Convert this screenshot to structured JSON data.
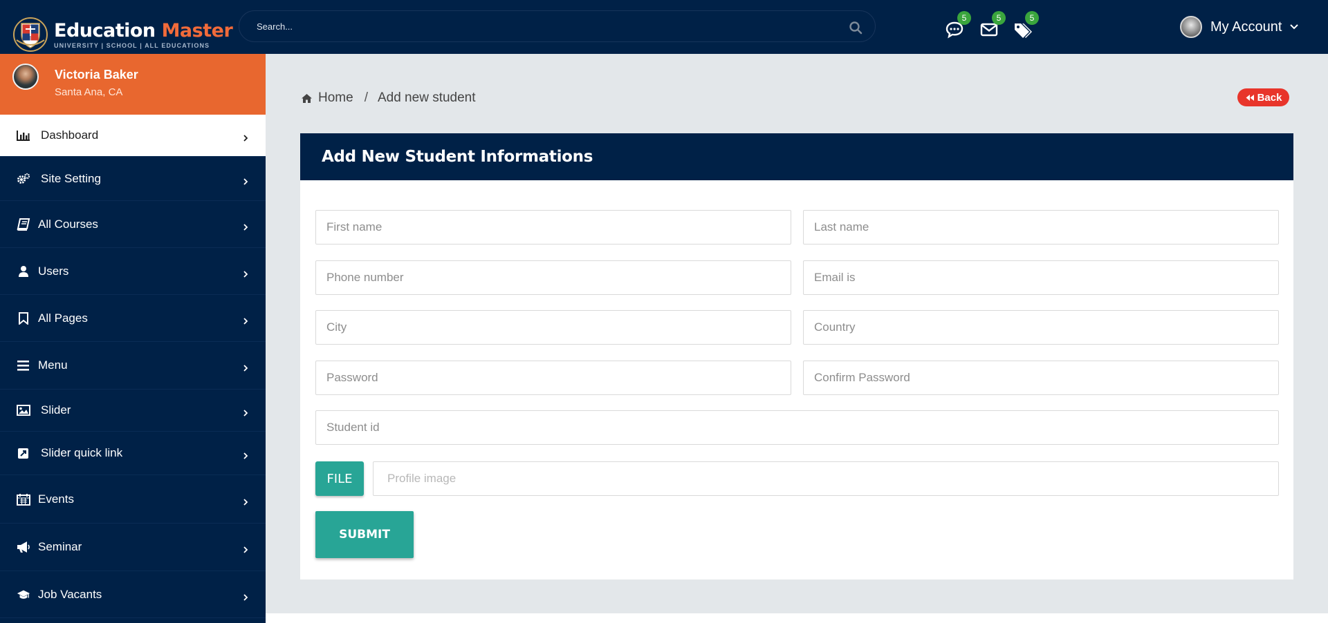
{
  "brand": {
    "name_part1": "Education",
    "name_part2": "Master",
    "tagline": "UNIVERSITY | SCHOOL | ALL EDUCATIONS",
    "accent_color": "#f26b3a",
    "navy_color": "#002147"
  },
  "search": {
    "placeholder": "Search..."
  },
  "notifications": [
    {
      "icon": "chat-icon",
      "count": "5"
    },
    {
      "icon": "envelope-icon",
      "count": "5"
    },
    {
      "icon": "tags-icon",
      "count": "5"
    }
  ],
  "account": {
    "label": "My Account"
  },
  "user": {
    "name": "Victoria Baker",
    "location": "Santa Ana, CA"
  },
  "sidebar": {
    "items": [
      {
        "label": "Dashboard",
        "icon": "bar-chart-icon",
        "active": true
      },
      {
        "label": "Site Setting",
        "icon": "gears-icon"
      },
      {
        "label": "All Courses",
        "icon": "book-icon"
      },
      {
        "label": "Users",
        "icon": "user-icon"
      },
      {
        "label": "All Pages",
        "icon": "bookmark-icon"
      },
      {
        "label": "Menu",
        "icon": "bars-icon"
      },
      {
        "label": "Slider",
        "icon": "image-icon"
      },
      {
        "label": "Slider quick link",
        "icon": "external-link-icon"
      },
      {
        "label": "Events",
        "icon": "calendar-icon"
      },
      {
        "label": "Seminar",
        "icon": "bullhorn-icon"
      },
      {
        "label": "Job Vacants",
        "icon": "graduation-cap-icon"
      }
    ]
  },
  "breadcrumb": {
    "home": "Home",
    "separator": "/",
    "current": "Add new student"
  },
  "back_button": {
    "label": "Back"
  },
  "form": {
    "title": "Add New Student Informations",
    "fields": {
      "first_name": "First name",
      "last_name": "Last name",
      "phone": "Phone number",
      "email": "Email is",
      "city": "City",
      "country": "Country",
      "password": "Password",
      "confirm_password": "Confirm Password",
      "student_id": "Student id",
      "profile_image": "Profile image"
    },
    "file_button": "FILE",
    "submit_button": "SUBMIT",
    "button_color": "#28a596"
  },
  "back_color": "#e8352b",
  "badge_color": "#3aa53d"
}
